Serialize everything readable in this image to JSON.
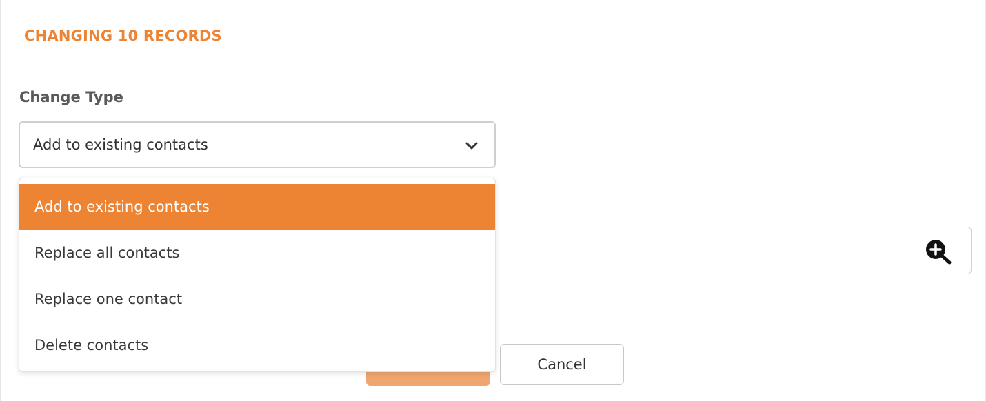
{
  "dialog": {
    "title": "CHANGING 10 RECORDS"
  },
  "change_type": {
    "label": "Change Type",
    "selected_value": "Add to existing contacts",
    "options": [
      "Add to existing contacts",
      "Replace all contacts",
      "Replace one contact",
      "Delete contacts"
    ],
    "selected_index": 0
  },
  "footer": {
    "cancel_label": "Cancel"
  },
  "icons": {
    "dropdown": "chevron-down-icon",
    "contact_lookup": "zoom-in-icon"
  },
  "colors": {
    "accent": "#ec8434",
    "selected_item_text": "#ffffff",
    "primary_button_disabled": "#f0a66e"
  }
}
